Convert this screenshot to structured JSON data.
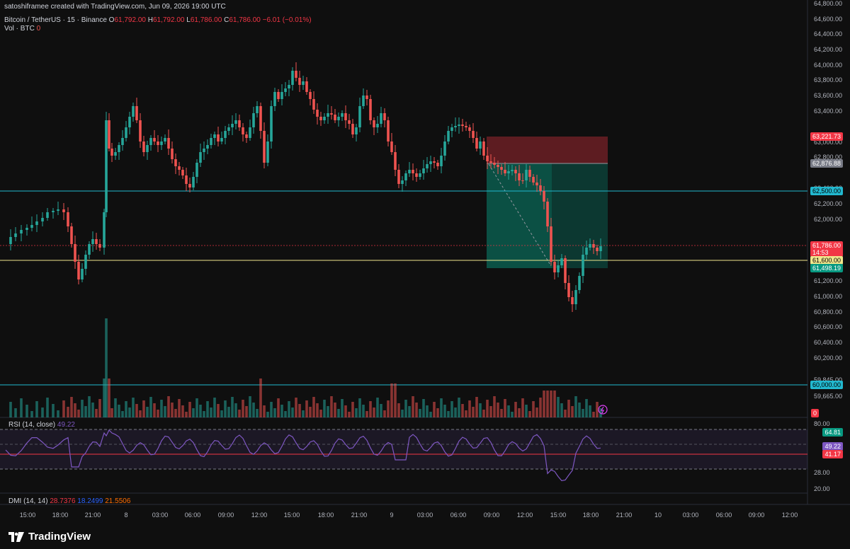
{
  "header": {
    "credit": "satoshiframee created with TradingView.com, Jun 09, 2026 19:00 UTC",
    "symbol": "Bitcoin / TetherUS · 15 · Binance",
    "o_label": "O",
    "o_value": "61,792.00",
    "h_label": "H",
    "h_value": "61,792.00",
    "l_label": "L",
    "l_value": "61,786.00",
    "c_label": "C",
    "c_value": "61,786.00",
    "change": "−6.01 (−0.01%)"
  },
  "volume_legend": {
    "label": "Vol · BTC",
    "value": "0"
  },
  "rsi_legend": {
    "label": "RSI (14, close)",
    "value": "49.22"
  },
  "dmi_legend": {
    "label": "DMI (14, 14)",
    "v1": "28.7376",
    "v2": "18.2499",
    "v3": "21.5506"
  },
  "price_axis": [
    "64,800.00",
    "64,600.00",
    "64,400.00",
    "64,200.00",
    "64,000.00",
    "63,800.00",
    "63,600.00",
    "63,400.00",
    "63,000.00",
    "62,800.00",
    "62,400.00",
    "62,200.00",
    "62,000.00",
    "61,400.00",
    "61,200.00",
    "61,000.00",
    "60,800.00",
    "60,600.00",
    "60,400.00",
    "60,200.00",
    "59,845.00",
    "59,665.00"
  ],
  "price_tags": {
    "sl": "63,221.73",
    "entry": "62,876.88",
    "level_62500": "62,500.00",
    "last": "61,786.00",
    "countdown": "14:53",
    "level_61600": "61,600.00",
    "tp": "61,498.19",
    "level_60000": "60,000.00",
    "vol_zero": "0"
  },
  "rsi_axis": [
    "80.00",
    "40.00",
    "28.00",
    "20.00"
  ],
  "rsi_tags": {
    "upper": "64.81",
    "value": "49.22",
    "lower": "41.17"
  },
  "time_axis": [
    "15:00",
    "18:00",
    "21:00",
    "8",
    "03:00",
    "06:00",
    "09:00",
    "12:00",
    "15:00",
    "18:00",
    "21:00",
    "9",
    "03:00",
    "06:00",
    "09:00",
    "12:00",
    "15:00",
    "18:00",
    "21:00",
    "10",
    "03:00",
    "06:00",
    "09:00",
    "12:00"
  ],
  "brand": "TradingView",
  "colors": {
    "up": "#26a69a",
    "down": "#ef5350",
    "cyan": "#22b8cf",
    "yellow": "#f0e68c",
    "rsi": "#7e57c2"
  }
}
